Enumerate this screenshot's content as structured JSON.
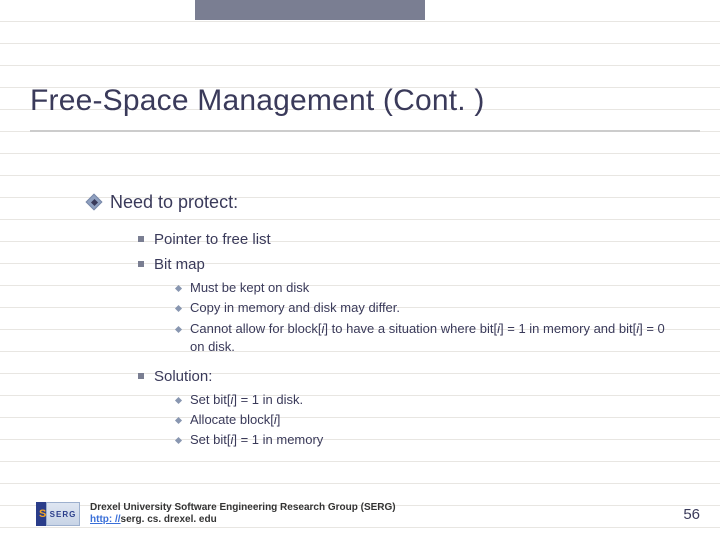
{
  "title": "Free-Space Management (Cont. )",
  "lvl1": "Need to protect:",
  "sub": {
    "item0": "Pointer to free list",
    "item1": "Bit map",
    "item2": "Solution:"
  },
  "bitmap_points": {
    "p0": "Must be kept on disk",
    "p1": "Copy in memory and disk may differ.",
    "p2a": "Cannot allow for block[",
    "p2b": "i",
    "p2c": "] to have a situation where bit[",
    "p2d": "i",
    "p2e": "] = 1 in memory and bit[",
    "p2f": "i",
    "p2g": "] = 0 on disk."
  },
  "solution_points": {
    "s0a": "Set bit[",
    "s0b": "i",
    "s0c": "] = 1 in disk.",
    "s1a": "Allocate block[",
    "s1b": "i",
    "s1c": "]",
    "s2a": "Set bit[",
    "s2b": "i",
    "s2c": "] = 1 in memory"
  },
  "footer": {
    "line1": "Drexel University Software Engineering Research Group (SERG)",
    "link_label": "http: //",
    "link_rest": "serg. cs. drexel. edu",
    "logo_text": "SERG"
  },
  "page_number": "56"
}
